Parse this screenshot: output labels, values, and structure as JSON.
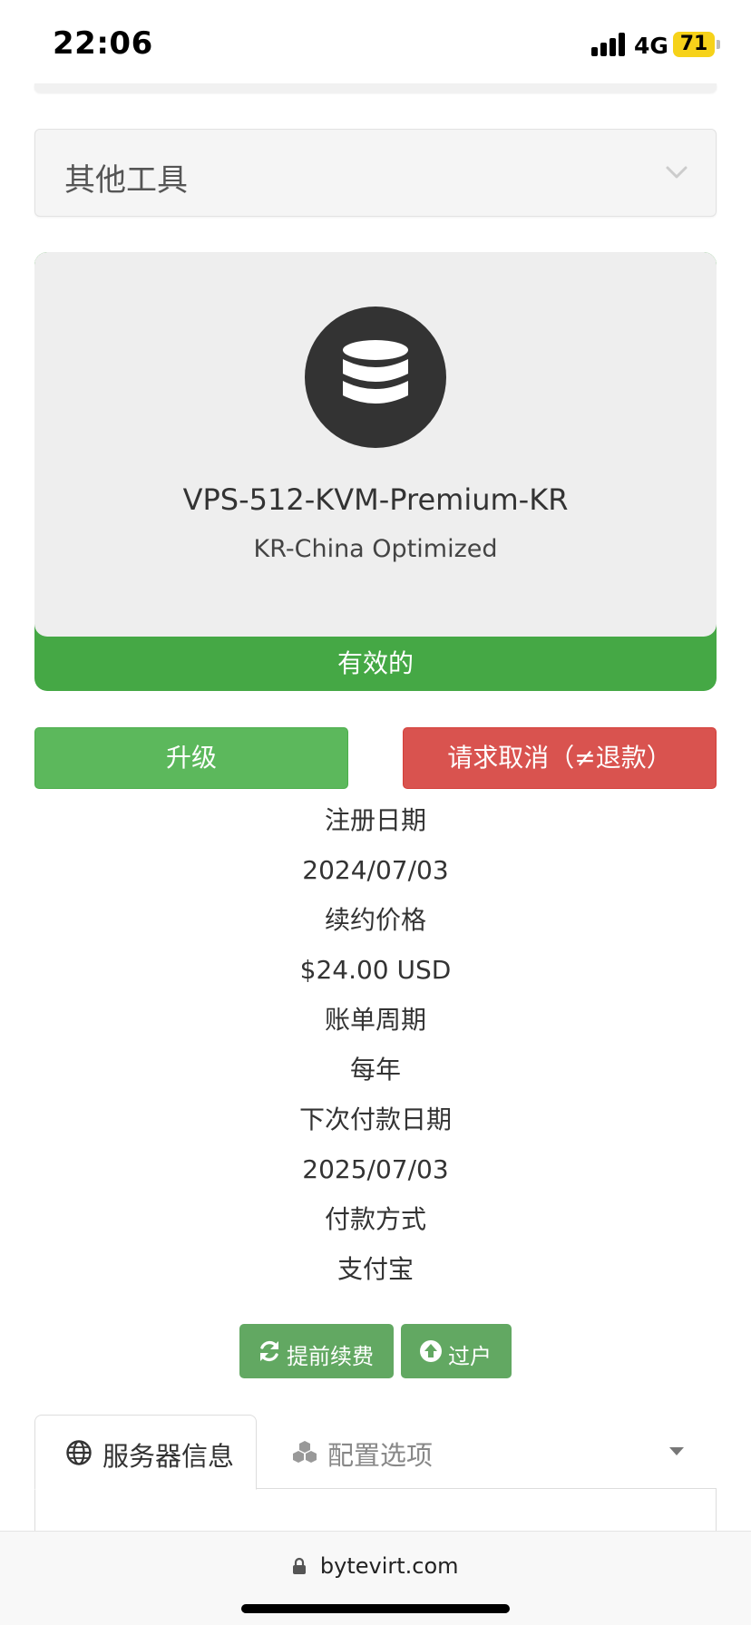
{
  "status_bar": {
    "time": "22:06",
    "network": "4G",
    "battery": "71"
  },
  "other_tools": {
    "label": "其他工具",
    "icon": "chevron-down-icon"
  },
  "product": {
    "icon": "database-icon",
    "name": "VPS-512-KVM-Premium-KR",
    "group": "KR-China Optimized",
    "status": "有效的",
    "colors": {
      "status_bg": "#45a845",
      "card_bg": "#eeeeee",
      "icon_circle": "#333333"
    }
  },
  "actions": {
    "upgrade": "升级",
    "cancel": "请求取消（≠退款）",
    "colors": {
      "upgrade": "#5cb85c",
      "cancel": "#d9534f"
    }
  },
  "info": {
    "reg_date_label": "注册日期",
    "reg_date": "2024/07/03",
    "renew_price_label": "续约价格",
    "renew_price": "$24.00 USD",
    "billing_cycle_label": "账单周期",
    "billing_cycle": "每年",
    "next_due_label": "下次付款日期",
    "next_due": "2025/07/03",
    "payment_method_label": "付款方式",
    "payment_method": "支付宝"
  },
  "buttons": {
    "renew": "提前续费",
    "renew_icon": "refresh-icon",
    "transfer": "过户",
    "transfer_icon": "arrow-circle-up-icon"
  },
  "tabs": [
    {
      "label": "服务器信息",
      "icon": "globe-icon",
      "active": true
    },
    {
      "label": "配置选项",
      "icon": "cubes-icon",
      "active": false
    }
  ],
  "browser": {
    "url": "bytevirt.com"
  }
}
